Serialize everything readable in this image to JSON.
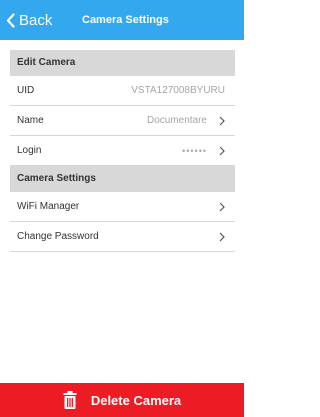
{
  "header": {
    "back_label": "Back",
    "title": "Camera Settings",
    "back_icon": "chevron-left-icon",
    "background": "#33a8ee"
  },
  "sections": [
    {
      "title": "Edit Camera",
      "rows": [
        {
          "label": "UID",
          "value": "VSTA127008BYURU"
        },
        {
          "label": "Name",
          "value": "Documentare",
          "chevron": true
        },
        {
          "label": "Login",
          "value": "••••••",
          "chevron": true
        }
      ]
    },
    {
      "title": "Camera Settings",
      "rows": [
        {
          "label": "WiFi Manager",
          "chevron": true
        },
        {
          "label": "Change Password",
          "chevron": true
        }
      ]
    }
  ],
  "footer": {
    "label": "Delete Camera",
    "icon": "trash-icon",
    "background": "#ed1c24"
  }
}
